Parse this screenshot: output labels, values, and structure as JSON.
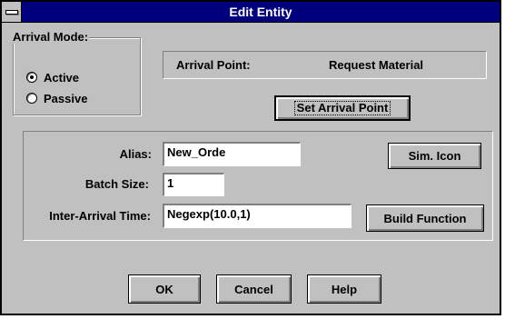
{
  "window": {
    "title": "Edit Entity"
  },
  "arrival_mode": {
    "label": "Arrival Mode:",
    "options": [
      {
        "label": "Active",
        "checked": true
      },
      {
        "label": "Passive",
        "checked": false
      }
    ]
  },
  "arrival_point": {
    "label": "Arrival Point:",
    "value": "Request Material",
    "set_button": "Set Arrival Point"
  },
  "fields": {
    "alias": {
      "label": "Alias:",
      "value": "New_Orde"
    },
    "batch_size": {
      "label": "Batch Size:",
      "value": "1"
    },
    "inter_arrival": {
      "label": "Inter-Arrival Time:",
      "value": "Negexp(10.0,1)"
    }
  },
  "buttons": {
    "sim_icon": "Sim. Icon",
    "build_function": "Build Function",
    "ok": "OK",
    "cancel": "Cancel",
    "help": "Help"
  },
  "colors": {
    "titlebar": "#00007f",
    "face": "#c0c0c0"
  },
  "icons": {
    "system_menu": "system-menu-icon"
  }
}
